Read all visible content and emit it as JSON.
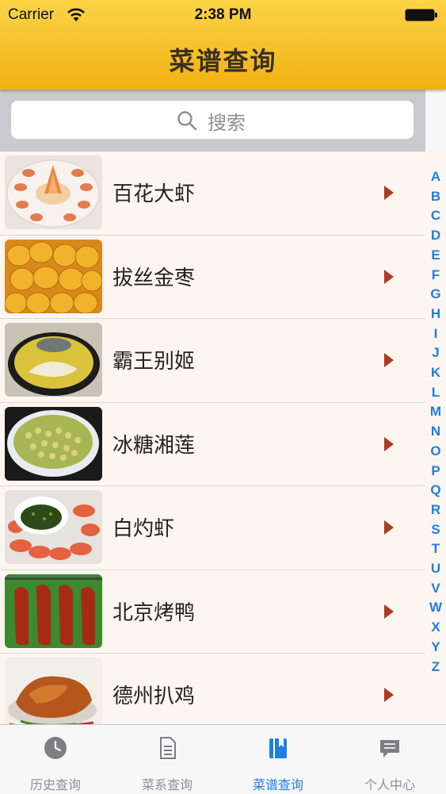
{
  "status_bar": {
    "carrier": "Carrier",
    "time": "2:38 PM"
  },
  "nav": {
    "title": "菜谱查询"
  },
  "search": {
    "placeholder": "搜索"
  },
  "recipes": [
    {
      "name": "百花大虾",
      "image": "shrimp-platter"
    },
    {
      "name": "拔丝金枣",
      "image": "candied-dates"
    },
    {
      "name": "霸王别姬",
      "image": "turtle-chicken-soup"
    },
    {
      "name": "冰糖湘莲",
      "image": "lotus-seed-soup"
    },
    {
      "name": "白灼虾",
      "image": "boiled-shrimp"
    },
    {
      "name": "北京烤鸭",
      "image": "roast-ducks"
    },
    {
      "name": "德州扒鸡",
      "image": "braised-chicken"
    }
  ],
  "index_letters": [
    "A",
    "B",
    "C",
    "D",
    "E",
    "F",
    "G",
    "H",
    "I",
    "J",
    "K",
    "L",
    "M",
    "N",
    "O",
    "P",
    "Q",
    "R",
    "S",
    "T",
    "U",
    "V",
    "W",
    "X",
    "Y",
    "Z"
  ],
  "tabs": [
    {
      "label": "历史查询",
      "icon": "clock-icon",
      "active": false
    },
    {
      "label": "菜系查询",
      "icon": "document-icon",
      "active": false
    },
    {
      "label": "菜谱查询",
      "icon": "book-icon",
      "active": true
    },
    {
      "label": "个人中心",
      "icon": "chat-bubble-icon",
      "active": false
    }
  ],
  "colors": {
    "nav_bar": "#f4bf22",
    "accent": "#1e7fe0",
    "chevron": "#b03a1f",
    "list_bg": "#fdf6f0"
  }
}
